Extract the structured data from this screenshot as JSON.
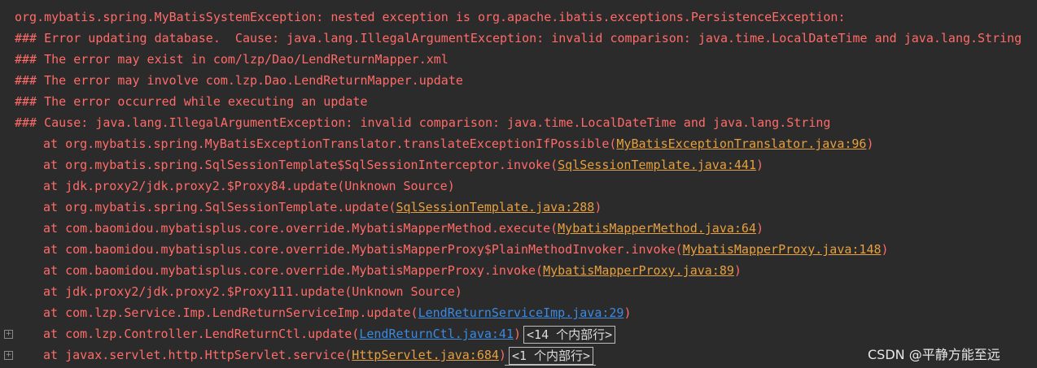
{
  "console": {
    "header_lines": [
      "org.mybatis.spring.MyBatisSystemException: nested exception is org.apache.ibatis.exceptions.PersistenceException: ",
      "### Error updating database.  Cause: java.lang.IllegalArgumentException: invalid comparison: java.time.LocalDateTime and java.lang.String",
      "### The error may exist in com/lzp/Dao/LendReturnMapper.xml",
      "### The error may involve com.lzp.Dao.LendReturnMapper.update",
      "### The error occurred while executing an update",
      "### Cause: java.lang.IllegalArgumentException: invalid comparison: java.time.LocalDateTime and java.lang.String"
    ],
    "frames": [
      {
        "text": "at org.mybatis.spring.MyBatisExceptionTranslator.translateExceptionIfPossible(",
        "link": "MyBatisExceptionTranslator.java:96",
        "end": ")"
      },
      {
        "text": "at org.mybatis.spring.SqlSessionTemplate$SqlSessionInterceptor.invoke(",
        "link": "SqlSessionTemplate.java:441",
        "end": ")"
      },
      {
        "text": "at jdk.proxy2/jdk.proxy2.$Proxy84.update(Unknown Source)"
      },
      {
        "text": "at org.mybatis.spring.SqlSessionTemplate.update(",
        "link": "SqlSessionTemplate.java:288",
        "end": ")"
      },
      {
        "text": "at com.baomidou.mybatisplus.core.override.MybatisMapperMethod.execute(",
        "link": "MybatisMapperMethod.java:64",
        "end": ")"
      },
      {
        "text": "at com.baomidou.mybatisplus.core.override.MybatisMapperProxy$PlainMethodInvoker.invoke(",
        "link": "MybatisMapperProxy.java:148",
        "end": ")"
      },
      {
        "text": "at com.baomidou.mybatisplus.core.override.MybatisMapperProxy.invoke(",
        "link": "MybatisMapperProxy.java:89",
        "end": ")"
      },
      {
        "text": "at jdk.proxy2/jdk.proxy2.$Proxy111.update(Unknown Source)"
      },
      {
        "text": "at com.lzp.Service.Imp.LendReturnServiceImp.update(",
        "link": "LendReturnServiceImp.java:29",
        "end": ")",
        "link_color": "blue"
      },
      {
        "text": "at com.lzp.Controller.LendReturnCtl.update(",
        "link": "LendReturnCtl.java:41",
        "end": ")",
        "link_color": "blue",
        "fold": "<14 个内部行>",
        "gutter": "+"
      },
      {
        "text": "at javax.servlet.http.HttpServlet.service(",
        "link": "HttpServlet.java:684",
        "end": ")",
        "fold": "<1 个内部行>",
        "gutter": "+"
      }
    ]
  },
  "watermark": "CSDN @平静方能至远",
  "colors": {
    "background": "#2b2b2b",
    "error_text": "#ff6b68",
    "library_link": "#e6a040",
    "project_link": "#3c8ae0"
  },
  "icons": {
    "fold_toggle": "plus-box-icon"
  }
}
